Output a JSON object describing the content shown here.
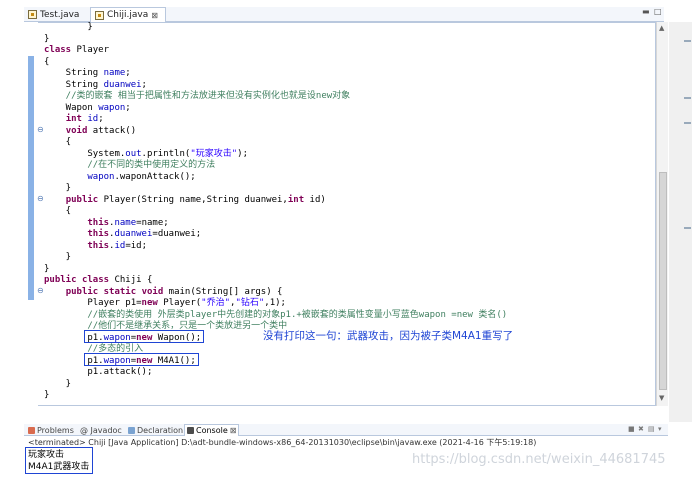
{
  "editor": {
    "tabs": [
      {
        "label": "Test.java"
      },
      {
        "label": "Chiji.java",
        "close": "⊠"
      }
    ],
    "code_lines": [
      [
        {
          "t": "        }",
          "c": ""
        }
      ],
      [
        {
          "t": "}",
          "c": ""
        }
      ],
      [
        {
          "t": "class",
          "c": "kw"
        },
        {
          "t": " Player",
          "c": ""
        }
      ],
      [
        {
          "t": "{",
          "c": ""
        }
      ],
      [
        {
          "t": "    String ",
          "c": ""
        },
        {
          "t": "name",
          "c": "fld"
        },
        {
          "t": ";",
          "c": ""
        }
      ],
      [
        {
          "t": "    String ",
          "c": ""
        },
        {
          "t": "duanwei",
          "c": "fld"
        },
        {
          "t": ";",
          "c": ""
        }
      ],
      [
        {
          "t": "    //类的嵌套 相当于把属性和方法放进来但没有实例化也就是设new对象",
          "c": "cmt"
        }
      ],
      [
        {
          "t": "    Wapon ",
          "c": ""
        },
        {
          "t": "wapon",
          "c": "fld"
        },
        {
          "t": ";",
          "c": ""
        }
      ],
      [
        {
          "t": "    ",
          "c": ""
        },
        {
          "t": "int",
          "c": "kw"
        },
        {
          "t": " ",
          "c": ""
        },
        {
          "t": "id",
          "c": "fld"
        },
        {
          "t": ";",
          "c": ""
        }
      ],
      [
        {
          "t": "    ",
          "c": ""
        },
        {
          "t": "void",
          "c": "kw"
        },
        {
          "t": " attack()",
          "c": ""
        }
      ],
      [
        {
          "t": "    {",
          "c": ""
        }
      ],
      [
        {
          "t": "        System.",
          "c": ""
        },
        {
          "t": "out",
          "c": "fld"
        },
        {
          "t": ".println(",
          "c": ""
        },
        {
          "t": "\"玩家攻击\"",
          "c": "str"
        },
        {
          "t": ");",
          "c": ""
        }
      ],
      [
        {
          "t": "        //在不同的类中使用定义的方法",
          "c": "cmt"
        }
      ],
      [
        {
          "t": "        ",
          "c": ""
        },
        {
          "t": "wapon",
          "c": "fld"
        },
        {
          "t": ".waponAttack();",
          "c": ""
        }
      ],
      [
        {
          "t": "    }",
          "c": ""
        }
      ],
      [
        {
          "t": "    ",
          "c": ""
        },
        {
          "t": "public",
          "c": "kw"
        },
        {
          "t": " Player(String name,String duanwei,",
          "c": ""
        },
        {
          "t": "int",
          "c": "kw"
        },
        {
          "t": " id)",
          "c": ""
        }
      ],
      [
        {
          "t": "    {",
          "c": ""
        }
      ],
      [
        {
          "t": "        ",
          "c": ""
        },
        {
          "t": "this",
          "c": "kw"
        },
        {
          "t": ".",
          "c": ""
        },
        {
          "t": "name",
          "c": "fld"
        },
        {
          "t": "=name;",
          "c": ""
        }
      ],
      [
        {
          "t": "        ",
          "c": ""
        },
        {
          "t": "this",
          "c": "kw"
        },
        {
          "t": ".",
          "c": ""
        },
        {
          "t": "duanwei",
          "c": "fld"
        },
        {
          "t": "=duanwei;",
          "c": ""
        }
      ],
      [
        {
          "t": "        ",
          "c": ""
        },
        {
          "t": "this",
          "c": "kw"
        },
        {
          "t": ".",
          "c": ""
        },
        {
          "t": "id",
          "c": "fld"
        },
        {
          "t": "=id;",
          "c": ""
        }
      ],
      [
        {
          "t": "    }",
          "c": ""
        }
      ],
      [
        {
          "t": "}",
          "c": ""
        }
      ],
      [
        {
          "t": "public",
          "c": "kw"
        },
        {
          "t": " ",
          "c": ""
        },
        {
          "t": "class",
          "c": "kw"
        },
        {
          "t": " Chiji {",
          "c": ""
        }
      ],
      [
        {
          "t": "    ",
          "c": ""
        },
        {
          "t": "public",
          "c": "kw"
        },
        {
          "t": " ",
          "c": ""
        },
        {
          "t": "static",
          "c": "kw"
        },
        {
          "t": " ",
          "c": ""
        },
        {
          "t": "void",
          "c": "kw"
        },
        {
          "t": " main(String[] args) {",
          "c": ""
        }
      ],
      [
        {
          "t": "        Player p1=",
          "c": ""
        },
        {
          "t": "new",
          "c": "kw"
        },
        {
          "t": " Player(",
          "c": ""
        },
        {
          "t": "\"乔治\"",
          "c": "str"
        },
        {
          "t": ",",
          "c": ""
        },
        {
          "t": "\"钻石\"",
          "c": "str"
        },
        {
          "t": ",1);",
          "c": ""
        }
      ],
      [
        {
          "t": "        //嵌套的类使用 外层类player中先创建的对象p1.+被嵌套的类属性变量小写蓝色wapon =new 类名()",
          "c": "cmt"
        }
      ],
      [
        {
          "t": "        //他们不是继承关系，只是一个类放进另一个类中",
          "c": "cmt"
        }
      ],
      [
        {
          "t": "        p1.",
          "c": ""
        },
        {
          "t": "wapon",
          "c": "fld"
        },
        {
          "t": "=",
          "c": ""
        },
        {
          "t": "new",
          "c": "kw"
        },
        {
          "t": " Wapon();",
          "c": ""
        }
      ],
      [
        {
          "t": "        //多态的引入",
          "c": "cmt"
        }
      ],
      [
        {
          "t": "        p1.",
          "c": ""
        },
        {
          "t": "wapon",
          "c": "fld"
        },
        {
          "t": "=",
          "c": ""
        },
        {
          "t": "new",
          "c": "kw"
        },
        {
          "t": " M4A1();",
          "c": ""
        }
      ],
      [
        {
          "t": "        p1.attack();",
          "c": ""
        }
      ],
      [
        {
          "t": "    }",
          "c": ""
        }
      ],
      [
        {
          "t": "}",
          "c": ""
        }
      ]
    ]
  },
  "annotation": "没有打印这一句：武器攻击，因为被子类M4A1重写了",
  "views": {
    "tabs": [
      {
        "label": "Problems"
      },
      {
        "label": "@ Javadoc"
      },
      {
        "label": "Declaration"
      },
      {
        "label": "Console",
        "close": "⊠"
      }
    ]
  },
  "console": {
    "header": "<terminated> Chiji [Java Application] D:\\adt-bundle-windows-x86_64-20131030\\eclipse\\bin\\javaw.exe (2021-4-16 下午5:19:18)",
    "output": [
      "玩家攻击",
      "M4A1武器攻击"
    ]
  },
  "watermark": "https://blog.csdn.net/weixin_44681745",
  "colors": {
    "highlight": "#1f45d4",
    "keyword": "#7f0055",
    "field": "#0000c0",
    "string": "#2a00ff",
    "comment": "#3f7f5f"
  }
}
